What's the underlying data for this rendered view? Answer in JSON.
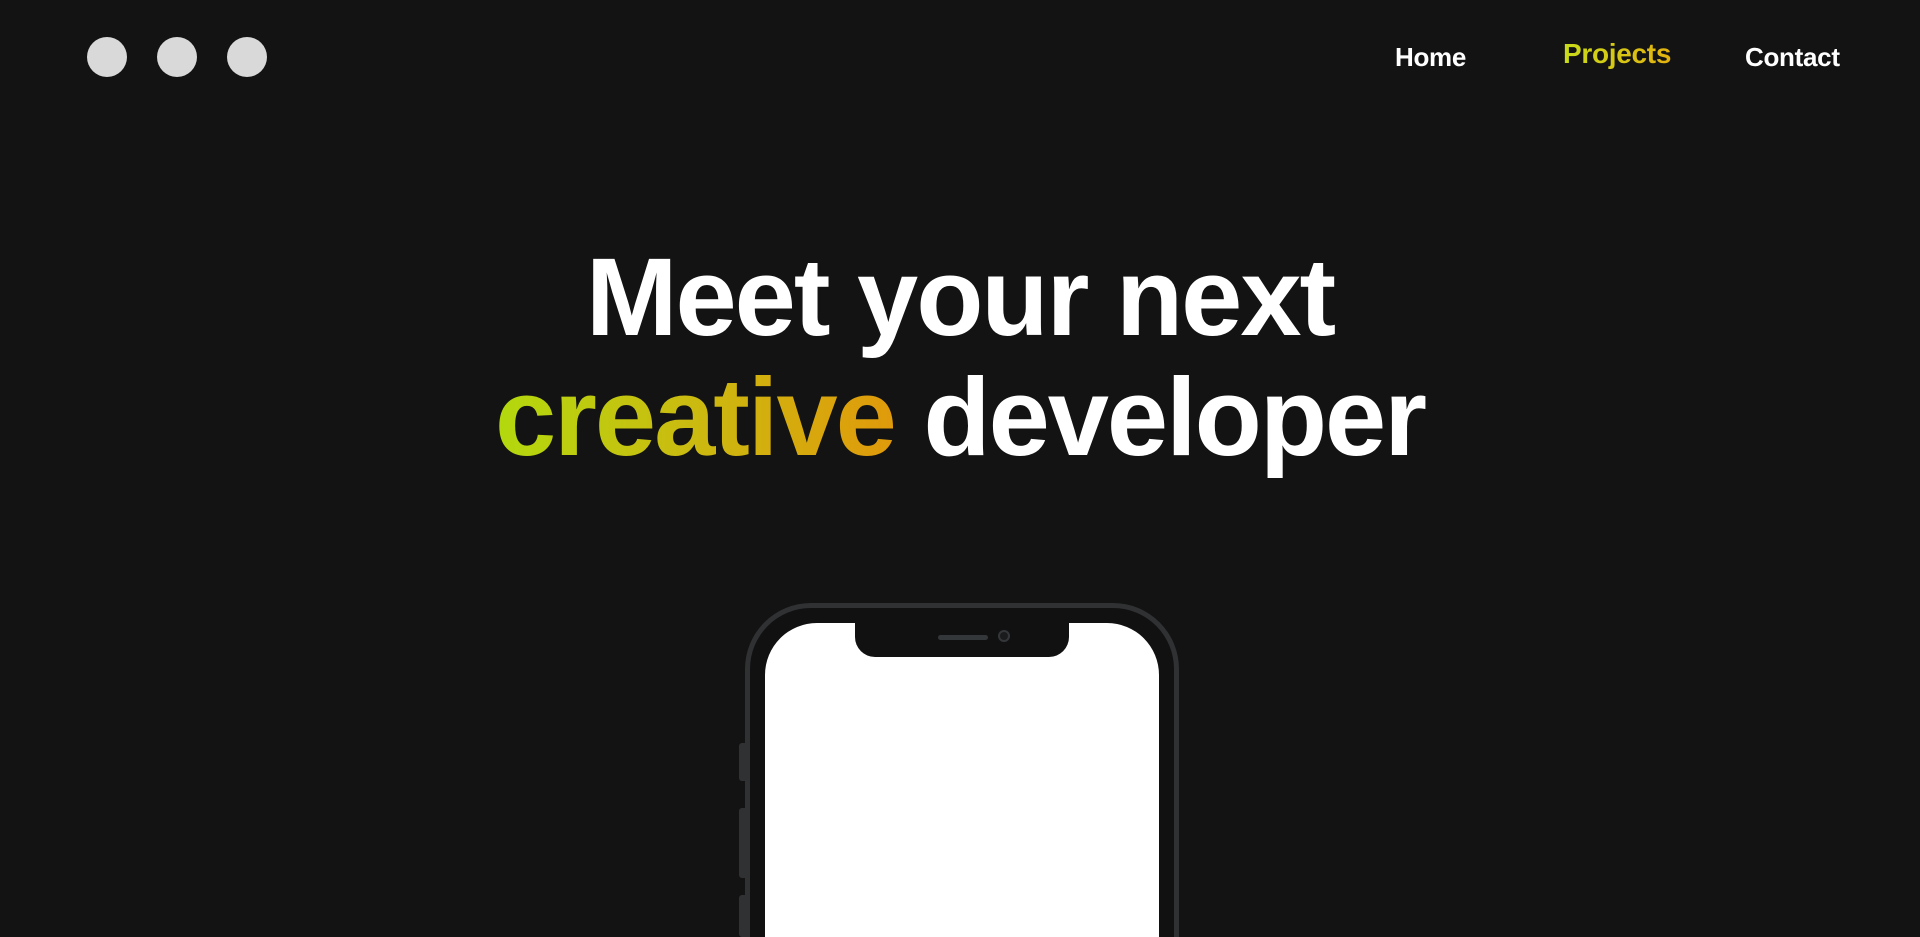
{
  "window_controls": {
    "dots": [
      "window-dot",
      "window-dot",
      "window-dot"
    ]
  },
  "nav": {
    "home": "Home",
    "projects": "Projects",
    "contact": "Contact",
    "active": "Projects"
  },
  "hero": {
    "line1": "Meet your next",
    "highlight": "creative",
    "line2_rest": "developer"
  },
  "colors": {
    "background": "#131313",
    "text": "#ffffff",
    "accent_start": "#b3d90e",
    "accent_end": "#e09a0b",
    "dot": "#d9d9d9",
    "phone_frame": "#2f3133"
  },
  "phone": {
    "device": "smartphone-mockup",
    "screen_color": "#ffffff"
  }
}
